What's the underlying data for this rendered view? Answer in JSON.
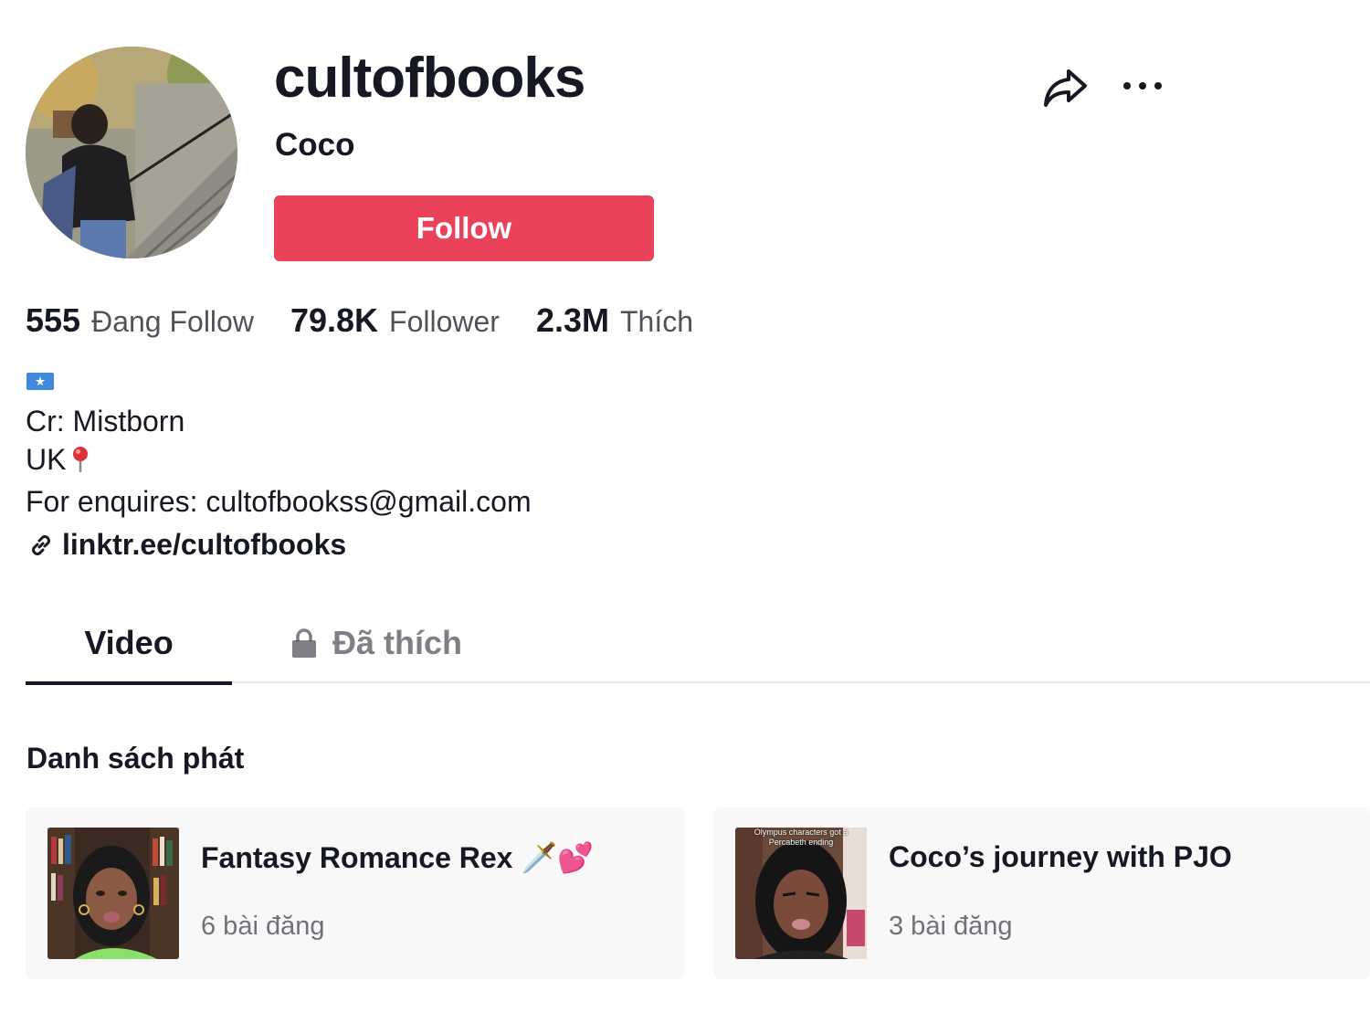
{
  "profile": {
    "username": "cultofbooks",
    "nickname": "Coco",
    "follow_label": "Follow"
  },
  "stats": [
    {
      "value": "555",
      "label": "Đang Follow"
    },
    {
      "value": "79.8K",
      "label": "Follower"
    },
    {
      "value": "2.3M",
      "label": "Thích"
    }
  ],
  "bio": {
    "line1": "Cr: Mistborn",
    "line2": "UK",
    "line3": "For enquires: cultofbookss@gmail.com"
  },
  "link": {
    "text": "linktr.ee/cultofbooks"
  },
  "tabs": [
    {
      "label": "Video"
    },
    {
      "label": "Đã thích"
    }
  ],
  "playlists": {
    "title": "Danh sách phát",
    "items": [
      {
        "title": "Fantasy Romance Rex 🗡️💕",
        "count": "6 bài đăng"
      },
      {
        "title": "Coco’s journey with PJO",
        "count": "3 bài đăng",
        "thumb_caption": "Olympus characters got a Percabeth ending"
      }
    ]
  },
  "icons": {
    "share": "share-icon",
    "more": "more-icon",
    "link": "link-icon",
    "lock": "lock-icon",
    "flag": "somalia-flag-icon",
    "pin": "round-pushpin-icon"
  },
  "colors": {
    "follow_button": "#ea425b",
    "text_primary": "#161823",
    "card_background": "#f8f8f8"
  }
}
